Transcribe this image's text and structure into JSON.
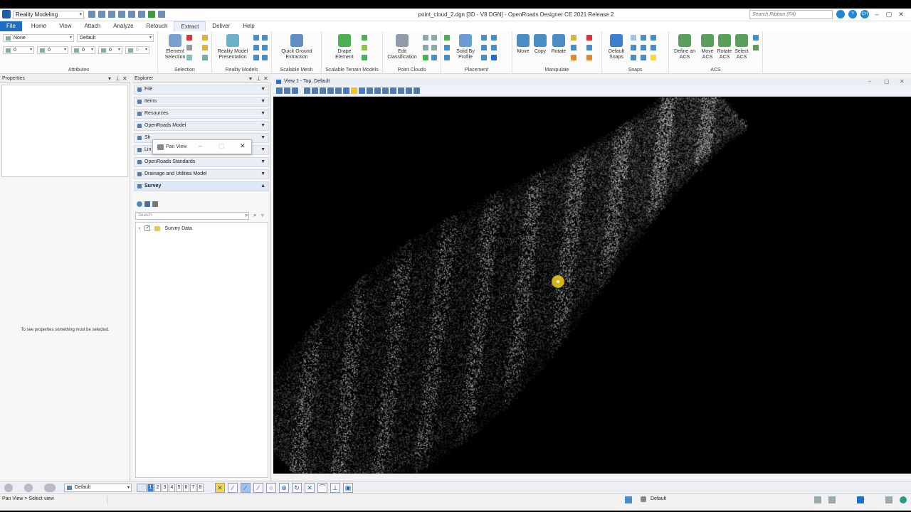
{
  "titlebar": {
    "workspace": "Reality Modeling",
    "title": "point_cloud_2.dgn [3D - V8 DGN] - OpenRoads Designer CE 2021 Release 2",
    "search_placeholder": "Search Ribbon (F4)",
    "user_initials": "CH"
  },
  "tabs": [
    "File",
    "Home",
    "View",
    "Attach",
    "Analyze",
    "Retouch",
    "Extract",
    "Deliver",
    "Help"
  ],
  "active_tab": "Extract",
  "ribbon": {
    "attributes": {
      "level": "None",
      "style": "Default",
      "color": "0",
      "weight": "0",
      "linestyle": "0",
      "transparency": "0",
      "priority": "0",
      "label": "Attributes"
    },
    "groups": {
      "selection": {
        "label": "Selection",
        "element_selection": "Element Selection"
      },
      "reality_models": {
        "label": "Reality Models",
        "presentation": "Reality Model Presentation"
      },
      "scalable_mesh": {
        "label": "Scalable Mesh",
        "quick_ground": "Quick Ground Extraction"
      },
      "scalable_terrain": {
        "label": "Scalable Terrain Models",
        "drape": "Drape Element"
      },
      "point_clouds": {
        "label": "Point Clouds",
        "edit_classification": "Edit Classification"
      },
      "placement": {
        "label": "Placement",
        "solid_by_profile": "Solid By Profile"
      },
      "manipulate": {
        "label": "Manipulate",
        "move": "Move",
        "copy": "Copy",
        "rotate": "Rotate"
      },
      "snaps": {
        "label": "Snaps",
        "default_snaps": "Default Snaps"
      },
      "acs": {
        "label": "ACS",
        "define": "Define an ACS",
        "move": "Move ACS",
        "rotate": "Rotate ACS",
        "select": "Select ACS"
      }
    }
  },
  "properties": {
    "title": "Properties",
    "empty_message": "To see properties something must be selected."
  },
  "explorer": {
    "title": "Explorer",
    "sections": [
      "File",
      "Items",
      "Resources",
      "OpenRoads Model",
      "Sheet",
      "Links",
      "OpenRoads Standards",
      "Drainage and Utilities Model",
      "Survey"
    ],
    "sections_visible": [
      "File",
      "Items",
      "Resources",
      "OpenRoads Model",
      "Sh",
      "Lin",
      "OpenRoads Standards",
      "Drainage and Utilities Model",
      "Survey"
    ],
    "search_placeholder": "Search",
    "tree": [
      {
        "label": "Survey Data",
        "checked": true
      }
    ]
  },
  "pan_dialog": {
    "title": "Pan View"
  },
  "view": {
    "title": "View 1 - Top, Default"
  },
  "bottom": {
    "active_model": "Default",
    "view_numbers": [
      "1",
      "2",
      "3",
      "4",
      "5",
      "6",
      "7",
      "8"
    ]
  },
  "status": {
    "prompt": "Pan View > Select view",
    "active_level": "Default"
  }
}
